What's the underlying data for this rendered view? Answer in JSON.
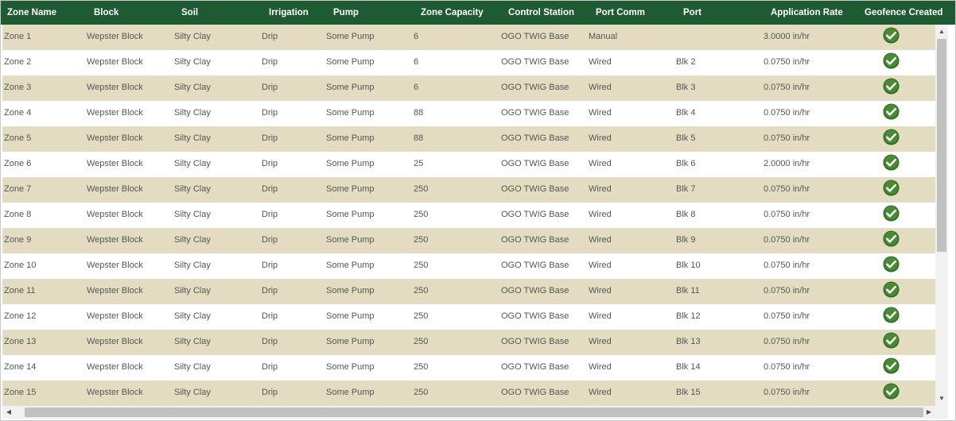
{
  "columns": [
    "Zone Name",
    "Block",
    "Soil",
    "Irrigation",
    "Pump",
    "Zone Capacity",
    "Control Station",
    "Port Comm",
    "Port",
    "Application Rate",
    "Geofence Created"
  ],
  "rows": [
    {
      "zone": "Zone 1",
      "block": "Wepster Block",
      "soil": "Silty Clay",
      "irrigation": "Drip",
      "pump": "Some Pump",
      "capacity": "6",
      "station": "OGO TWIG Base",
      "comm": "Manual",
      "port": "",
      "rate": "3.0000 in/hr",
      "geofence": "check-icon"
    },
    {
      "zone": "Zone 2",
      "block": "Wepster Block",
      "soil": "Silty Clay",
      "irrigation": "Drip",
      "pump": "Some Pump",
      "capacity": "6",
      "station": "OGO TWIG Base",
      "comm": "Wired",
      "port": "Blk 2",
      "rate": "0.0750 in/hr",
      "geofence": "check-icon"
    },
    {
      "zone": "Zone 3",
      "block": "Wepster Block",
      "soil": "Silty Clay",
      "irrigation": "Drip",
      "pump": "Some Pump",
      "capacity": "6",
      "station": "OGO TWIG Base",
      "comm": "Wired",
      "port": "Blk 3",
      "rate": "0.0750 in/hr",
      "geofence": "check-icon"
    },
    {
      "zone": "Zone 4",
      "block": "Wepster Block",
      "soil": "Silty Clay",
      "irrigation": "Drip",
      "pump": "Some Pump",
      "capacity": "88",
      "station": "OGO TWIG Base",
      "comm": "Wired",
      "port": "Blk 4",
      "rate": "0.0750 in/hr",
      "geofence": "check-icon"
    },
    {
      "zone": "Zone 5",
      "block": "Wepster Block",
      "soil": "Silty Clay",
      "irrigation": "Drip",
      "pump": "Some Pump",
      "capacity": "88",
      "station": "OGO TWIG Base",
      "comm": "Wired",
      "port": "Blk 5",
      "rate": "0.0750 in/hr",
      "geofence": "check-icon"
    },
    {
      "zone": "Zone 6",
      "block": "Wepster Block",
      "soil": "Silty Clay",
      "irrigation": "Drip",
      "pump": "Some Pump",
      "capacity": "25",
      "station": "OGO TWIG Base",
      "comm": "Wired",
      "port": "Blk 6",
      "rate": "2.0000 in/hr",
      "geofence": "check-icon"
    },
    {
      "zone": "Zone 7",
      "block": "Wepster Block",
      "soil": "Silty Clay",
      "irrigation": "Drip",
      "pump": "Some Pump",
      "capacity": "250",
      "station": "OGO TWIG Base",
      "comm": "Wired",
      "port": "Blk 7",
      "rate": "0.0750 in/hr",
      "geofence": "check-icon"
    },
    {
      "zone": "Zone 8",
      "block": "Wepster Block",
      "soil": "Silty Clay",
      "irrigation": "Drip",
      "pump": "Some Pump",
      "capacity": "250",
      "station": "OGO TWIG Base",
      "comm": "Wired",
      "port": "Blk 8",
      "rate": "0.0750 in/hr",
      "geofence": "check-icon"
    },
    {
      "zone": "Zone 9",
      "block": "Wepster Block",
      "soil": "Silty Clay",
      "irrigation": "Drip",
      "pump": "Some Pump",
      "capacity": "250",
      "station": "OGO TWIG Base",
      "comm": "Wired",
      "port": "Blk 9",
      "rate": "0.0750 in/hr",
      "geofence": "check-icon"
    },
    {
      "zone": "Zone 10",
      "block": "Wepster Block",
      "soil": "Silty Clay",
      "irrigation": "Drip",
      "pump": "Some Pump",
      "capacity": "250",
      "station": "OGO TWIG Base",
      "comm": "Wired",
      "port": "Blk 10",
      "rate": "0.0750 in/hr",
      "geofence": "check-icon"
    },
    {
      "zone": "Zone 11",
      "block": "Wepster Block",
      "soil": "Silty Clay",
      "irrigation": "Drip",
      "pump": "Some Pump",
      "capacity": "250",
      "station": "OGO TWIG Base",
      "comm": "Wired",
      "port": "Blk 11",
      "rate": "0.0750 in/hr",
      "geofence": "check-icon"
    },
    {
      "zone": "Zone 12",
      "block": "Wepster Block",
      "soil": "Silty Clay",
      "irrigation": "Drip",
      "pump": "Some Pump",
      "capacity": "250",
      "station": "OGO TWIG Base",
      "comm": "Wired",
      "port": "Blk 12",
      "rate": "0.0750 in/hr",
      "geofence": "check-icon"
    },
    {
      "zone": "Zone 13",
      "block": "Wepster Block",
      "soil": "Silty Clay",
      "irrigation": "Drip",
      "pump": "Some Pump",
      "capacity": "250",
      "station": "OGO TWIG Base",
      "comm": "Wired",
      "port": "Blk 13",
      "rate": "0.0750 in/hr",
      "geofence": "check-icon"
    },
    {
      "zone": "Zone 14",
      "block": "Wepster Block",
      "soil": "Silty Clay",
      "irrigation": "Drip",
      "pump": "Some Pump",
      "capacity": "250",
      "station": "OGO TWIG Base",
      "comm": "Wired",
      "port": "Blk 14",
      "rate": "0.0750 in/hr",
      "geofence": "check-icon"
    },
    {
      "zone": "Zone 15",
      "block": "Wepster Block",
      "soil": "Silty Clay",
      "irrigation": "Drip",
      "pump": "Some Pump",
      "capacity": "250",
      "station": "OGO TWIG Base",
      "comm": "Wired",
      "port": "Blk 15",
      "rate": "0.0750 in/hr",
      "geofence": "check-icon"
    }
  ],
  "colors": {
    "header_bg": "#1e5a32",
    "row_alt_bg": "#e4dcc1",
    "row_bg": "#ffffff",
    "check_green": "#4a8a32"
  },
  "icons": {
    "scroll_up": "chevron-up-icon",
    "scroll_down": "chevron-down-icon",
    "scroll_left": "chevron-left-icon",
    "scroll_right": "chevron-right-icon"
  }
}
